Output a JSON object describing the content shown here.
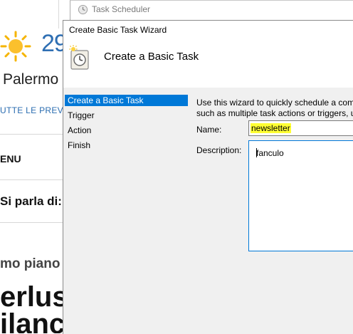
{
  "background_page": {
    "temperature": "29",
    "city": "Palermo",
    "link": "UTTE LE PREVI",
    "menu": "ENU",
    "parla": "Si parla di:",
    "breadcrumb": "mo piano /",
    "headline_line1": "erlus",
    "headline_line2": "ilanc"
  },
  "scheduler_window": {
    "title": "Task Scheduler"
  },
  "wizard": {
    "title": "Create Basic Task Wizard",
    "heading": "Create a Basic Task",
    "steps": [
      {
        "label": "Create a Basic Task",
        "active": true
      },
      {
        "label": "Trigger",
        "active": false
      },
      {
        "label": "Action",
        "active": false
      },
      {
        "label": "Finish",
        "active": false
      }
    ],
    "description_line1": "Use this wizard to quickly schedule a comm",
    "description_line2": "such as multiple task actions or triggers, u",
    "name_label": "Name:",
    "name_value": "newsletter",
    "description_label": "Description:",
    "description_value": "fanculo"
  },
  "colors": {
    "accent": "#0078d7",
    "highlight": "#ffff33",
    "weather_blue": "#2f6fb3"
  }
}
